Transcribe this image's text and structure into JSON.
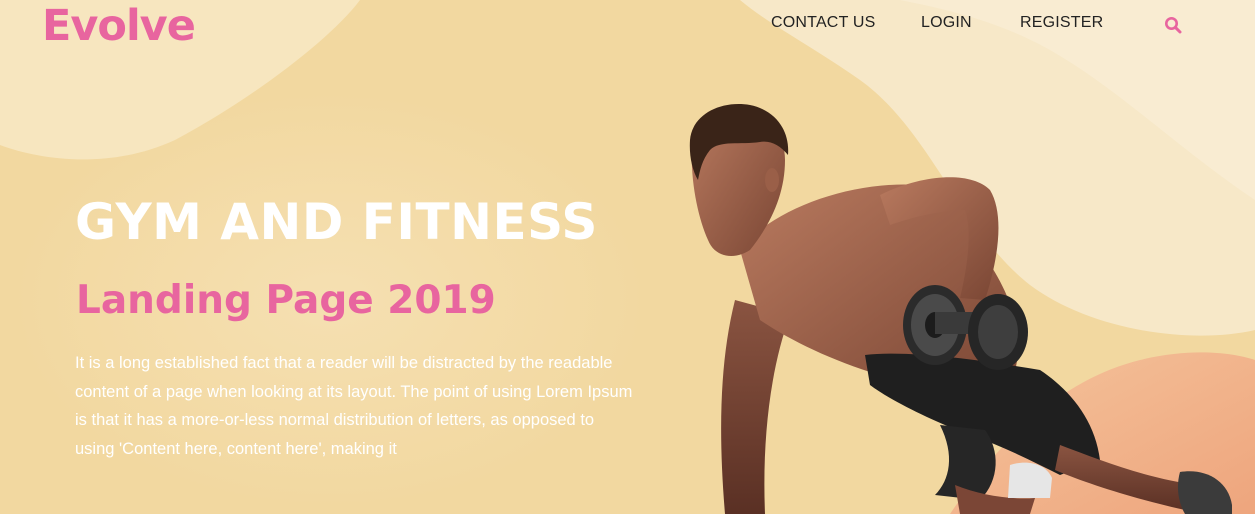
{
  "brand": {
    "name": "Evolve",
    "accent_color": "#e8659f",
    "background_color": "#f2d9a2"
  },
  "nav": {
    "items": [
      {
        "label": "CONTACT US"
      },
      {
        "label": "LOGIN"
      },
      {
        "label": "REGISTER"
      }
    ],
    "search_icon": "search-icon"
  },
  "hero": {
    "title": "GYM AND FITNESS",
    "subtitle": "Landing Page 2019",
    "description": "It is a long established fact that a reader will be distracted by the readable content of a page when looking at its layout. The point of using Lorem Ipsum is that it has a more-or-less normal distribution of letters, as opposed to using 'Content here, content here', making it",
    "image": "athlete-dumbbell-row-plank"
  }
}
